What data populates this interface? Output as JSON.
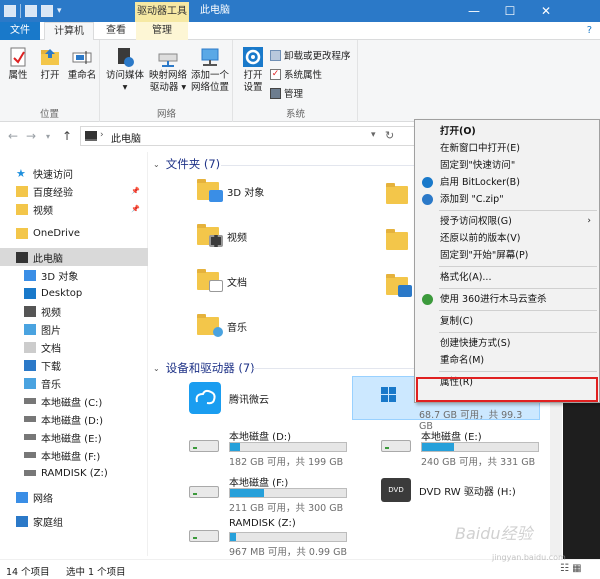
{
  "window": {
    "drive_tools_tab": "驱动器工具",
    "title": "此电脑",
    "minimize": "—",
    "maximize": "☐",
    "close": "✕"
  },
  "ribbon_tabs": [
    "文件",
    "计算机",
    "查看",
    "管理"
  ],
  "ribbon": {
    "location": {
      "label": "位置",
      "properties": "属性",
      "open": "打开",
      "rename": "重命名"
    },
    "network": {
      "label": "网络",
      "media": [
        "访问媒体",
        "▾"
      ],
      "map_drive": [
        "映射网络",
        "驱动器 ▾"
      ],
      "add_location": [
        "添加一个",
        "网络位置"
      ]
    },
    "system": {
      "label": "系统",
      "open_settings": [
        "打开",
        "设置"
      ],
      "uninstall": "卸载或更改程序",
      "sys_props": "系统属性",
      "manage": "管理"
    }
  },
  "address": {
    "path": "此电脑"
  },
  "sidebar": {
    "items": [
      {
        "label": "快速访问",
        "icon": "star-icon",
        "pin": false
      },
      {
        "label": "百度经验",
        "icon": "folder-icon",
        "pin": true
      },
      {
        "label": "视频",
        "icon": "video-folder-icon",
        "pin": true
      },
      {
        "label": "OneDrive",
        "icon": "onedrive-icon",
        "pin": false
      },
      {
        "label": "此电脑",
        "icon": "computer-icon",
        "pin": false,
        "selected": true
      },
      {
        "label": "3D 对象",
        "icon": "3d-objects-icon",
        "pin": false
      },
      {
        "label": "Desktop",
        "icon": "desktop-icon",
        "pin": false
      },
      {
        "label": "视频",
        "icon": "video-icon",
        "pin": false
      },
      {
        "label": "图片",
        "icon": "pictures-icon",
        "pin": false
      },
      {
        "label": "文档",
        "icon": "documents-icon",
        "pin": false
      },
      {
        "label": "下载",
        "icon": "downloads-icon",
        "pin": false
      },
      {
        "label": "音乐",
        "icon": "music-icon",
        "pin": false
      },
      {
        "label": "本地磁盘 (C:)",
        "icon": "drive-icon",
        "pin": false
      },
      {
        "label": "本地磁盘 (D:)",
        "icon": "drive-icon",
        "pin": false
      },
      {
        "label": "本地磁盘 (E:)",
        "icon": "drive-icon",
        "pin": false
      },
      {
        "label": "本地磁盘 (F:)",
        "icon": "drive-icon",
        "pin": false
      },
      {
        "label": "RAMDISK (Z:)",
        "icon": "drive-icon",
        "pin": false
      },
      {
        "label": "网络",
        "icon": "network-icon",
        "pin": false
      },
      {
        "label": "家庭组",
        "icon": "homegroup-icon",
        "pin": false
      }
    ]
  },
  "content": {
    "folders_header": "文件夹 (7)",
    "folders": [
      {
        "label": "3D 对象",
        "overlay": "#3a8ee6"
      },
      {
        "label": "视频",
        "overlay": "#3b3b3b"
      },
      {
        "label": "文档",
        "overlay": "#ffffff"
      },
      {
        "label": "音乐",
        "overlay": "#4aa3e0"
      }
    ],
    "devices_header": "设备和驱动器 (7)",
    "tencent_cloud": "腾讯微云",
    "selected_drive_info": "68.7 GB 可用，共 99.3 GB",
    "drives": [
      {
        "name": "本地磁盘 (D:)",
        "info": "182 GB 可用，共 199 GB",
        "used": 0.085
      },
      {
        "name": "本地磁盘 (E:)",
        "info": "240 GB 可用，共 331 GB",
        "used": 0.275
      },
      {
        "name": "本地磁盘 (F:)",
        "info": "211 GB 可用，共 300 GB",
        "used": 0.297
      },
      {
        "name": "RAMDISK (Z:)",
        "info": "967 MB 可用，共 0.99 GB",
        "used": 0.05
      }
    ],
    "dvd_drive": "DVD RW 驱动器 (H:)"
  },
  "context_menu": {
    "items": [
      {
        "label": "打开(O)",
        "bold": true
      },
      {
        "label": "在新窗口中打开(E)"
      },
      {
        "label": "固定到\"快速访问\""
      },
      {
        "label": "启用 BitLocker(B)",
        "icon": "bitlocker-shield-icon"
      },
      {
        "label": "添加到 \"C.zip\"",
        "icon": "zip-icon"
      },
      {
        "sep": true
      },
      {
        "label": "授予访问权限(G)",
        "sub": true
      },
      {
        "label": "还原以前的版本(V)"
      },
      {
        "label": "固定到\"开始\"屏幕(P)"
      },
      {
        "sep": true
      },
      {
        "label": "格式化(A)..."
      },
      {
        "sep": true
      },
      {
        "label": "使用 360进行木马云查杀",
        "icon": "360-icon"
      },
      {
        "sep": true
      },
      {
        "label": "复制(C)"
      },
      {
        "sep": true
      },
      {
        "label": "创建快捷方式(S)"
      },
      {
        "label": "重命名(M)"
      },
      {
        "sep": true
      },
      {
        "label": "属性(R)"
      }
    ]
  },
  "status": {
    "count": "14 个项目",
    "selected": "选中 1 个项目"
  },
  "watermark": {
    "brand": "Baidu经验",
    "url": "jingyan.baidu.com"
  },
  "colors": {
    "titlebar": "#2b79c8",
    "accent_blue": "#1979ca",
    "highlight_red": "#e02020",
    "selection": "#cce8ff"
  }
}
